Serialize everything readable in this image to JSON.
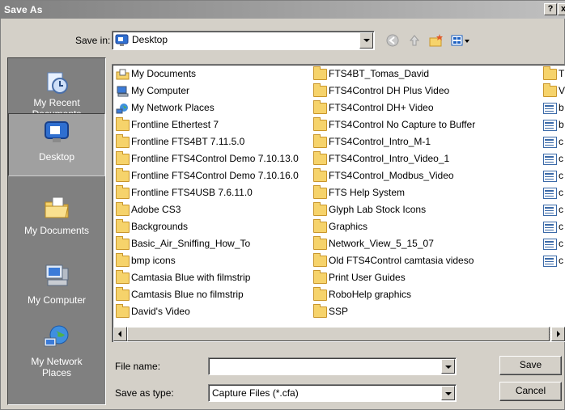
{
  "window": {
    "title": "Save As",
    "help_label": "?",
    "close_label": "x"
  },
  "save_in": {
    "label": "Save in:",
    "value": "Desktop",
    "icons": [
      "back-icon",
      "up-folder-icon",
      "new-folder-icon",
      "views-menu-icon"
    ]
  },
  "places": [
    {
      "label": "My Recent Documents",
      "icon": "recent-documents-icon"
    },
    {
      "label": "Desktop",
      "icon": "desktop-icon",
      "selected": true
    },
    {
      "label": "My Documents",
      "icon": "my-documents-icon"
    },
    {
      "label": "My Computer",
      "icon": "my-computer-icon"
    },
    {
      "label": "My Network Places",
      "icon": "network-places-icon"
    }
  ],
  "files": {
    "column1": [
      {
        "name": "My Documents",
        "type": "special"
      },
      {
        "name": "My Computer",
        "type": "special"
      },
      {
        "name": "My Network Places",
        "type": "special"
      },
      {
        "name": "Frontline Ethertest 7",
        "type": "folder"
      },
      {
        "name": "Frontline FTS4BT 7.11.5.0",
        "type": "folder"
      },
      {
        "name": "Frontline FTS4Control Demo 7.10.13.0",
        "type": "folder"
      },
      {
        "name": "Frontline FTS4Control Demo 7.10.16.0",
        "type": "folder"
      },
      {
        "name": "Frontline FTS4USB 7.6.11.0",
        "type": "folder"
      },
      {
        "name": "Adobe CS3",
        "type": "folder"
      },
      {
        "name": "Backgrounds",
        "type": "folder"
      },
      {
        "name": "Basic_Air_Sniffing_How_To",
        "type": "folder"
      },
      {
        "name": "bmp icons",
        "type": "folder"
      },
      {
        "name": "Camtasia Blue with filmstrip",
        "type": "folder"
      },
      {
        "name": "Camtasis Blue no filmstrip",
        "type": "folder"
      },
      {
        "name": "David's Video",
        "type": "folder"
      }
    ],
    "column2": [
      {
        "name": "FTS4BT_Tomas_David",
        "type": "folder"
      },
      {
        "name": "FTS4Control DH Plus Video",
        "type": "folder"
      },
      {
        "name": "FTS4Control DH+ Video",
        "type": "folder"
      },
      {
        "name": "FTS4Control No Capture to Buffer",
        "type": "folder"
      },
      {
        "name": "FTS4Control_Intro_M-1",
        "type": "folder"
      },
      {
        "name": "FTS4Control_Intro_Video_1",
        "type": "folder"
      },
      {
        "name": "FTS4Control_Modbus_Video",
        "type": "folder"
      },
      {
        "name": "FTS Help System",
        "type": "folder"
      },
      {
        "name": "Glyph Lab Stock Icons",
        "type": "folder"
      },
      {
        "name": "Graphics",
        "type": "folder"
      },
      {
        "name": "Network_View_5_15_07",
        "type": "folder"
      },
      {
        "name": "Old FTS4Control camtasia videso",
        "type": "folder"
      },
      {
        "name": "Print User Guides",
        "type": "folder"
      },
      {
        "name": "RoboHelp graphics",
        "type": "folder"
      },
      {
        "name": "SSP",
        "type": "folder"
      }
    ],
    "column3": [
      {
        "name": "T",
        "type": "folder"
      },
      {
        "name": "V",
        "type": "folder"
      },
      {
        "name": "b",
        "type": "file"
      },
      {
        "name": "b",
        "type": "file"
      },
      {
        "name": "c",
        "type": "file"
      },
      {
        "name": "c",
        "type": "file"
      },
      {
        "name": "c",
        "type": "file"
      },
      {
        "name": "c",
        "type": "file"
      },
      {
        "name": "c",
        "type": "file"
      },
      {
        "name": "c",
        "type": "file"
      },
      {
        "name": "c",
        "type": "file"
      },
      {
        "name": "c",
        "type": "file"
      }
    ]
  },
  "file_name": {
    "label": "File name:",
    "value": ""
  },
  "save_as_type": {
    "label": "Save as type:",
    "value": "Capture Files (*.cfa)"
  },
  "buttons": {
    "save": "Save",
    "cancel": "Cancel"
  }
}
